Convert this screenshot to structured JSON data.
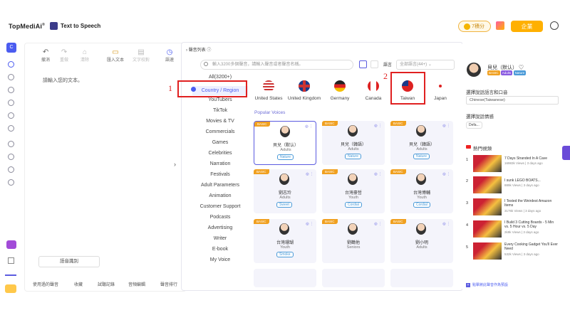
{
  "app": {
    "brand": "TopMediAi",
    "brand_mark": "®",
    "product": "Text to Speech"
  },
  "header": {
    "coins": "0",
    "coins_unit": "7積分",
    "enterprise": "企業"
  },
  "toolbar": {
    "undo": "撤消",
    "redo": "重做",
    "clear": "清除",
    "import": "匯入文本",
    "text_check": "文字校對",
    "speed": "語速"
  },
  "editor": {
    "placeholder": "請輸入您的文本。",
    "voice_clone": "語音識別"
  },
  "bottom_tools": [
    "使用過的聲音",
    "收藏",
    "試聽記錄",
    "音頻編輯",
    "聲音排行"
  ],
  "modal": {
    "title": "聲音列表",
    "search_placeholder": "輸入3200多個聲音，請輸入聲音或者聲音名稱。",
    "sort_label": "語言",
    "sort_value": "全部語言(44+)",
    "categories": [
      "All(3200+)",
      "Country / Region",
      "YouTubers",
      "TikTok",
      "Movies & TV",
      "Commercials",
      "Games",
      "Celebrities",
      "Narration",
      "Festivals",
      "Adult Parameters",
      "Animation",
      "Customer Support",
      "Podcasts",
      "Advertising",
      "Writer",
      "E-book",
      "My Voice"
    ],
    "countries": [
      "United States",
      "United Kingdom",
      "Germany",
      "Canada",
      "Taiwan",
      "Japan"
    ],
    "section_title": "Popular Voices",
    "voices": [
      {
        "badge": "BASIC",
        "name": "貝兒（默认）",
        "age": "Adults",
        "tag": "Nature"
      },
      {
        "badge": "BASIC",
        "name": "貝兒（韓語）",
        "age": "Adults",
        "tag": "Nature"
      },
      {
        "badge": "BASIC",
        "name": "貝兒（韓語）",
        "age": "Adults",
        "tag": "Nature"
      },
      {
        "badge": "BASIC",
        "name": "劉志玲",
        "age": "Adults",
        "tag": "Sweet"
      },
      {
        "badge": "BASIC",
        "name": "台灣豪哲",
        "age": "Youth",
        "tag": "Cordial"
      },
      {
        "badge": "BASIC",
        "name": "台灣博輔",
        "age": "Youth",
        "tag": "Cordial"
      },
      {
        "badge": "BASIC",
        "name": "台灣珊瑚",
        "age": "Youth",
        "tag": "Smoke"
      },
      {
        "badge": "BASIC",
        "name": "劉鶴他",
        "age": "Seniors",
        "tag": ""
      },
      {
        "badge": "BASIC",
        "name": "劉小明",
        "age": "Adults",
        "tag": ""
      }
    ],
    "annotations": [
      "1",
      "2"
    ]
  },
  "right_panel": {
    "voice_name": "貝兒（默认）",
    "badges": [
      "BASIC",
      "Adults",
      "Nature"
    ],
    "lang_label": "選擇說話語言和口音",
    "lang_value": "Chinese(Taiwanese)",
    "style_label": "選擇說話情感",
    "style_value": "Defa...",
    "trending_title": "熱門視頻",
    "videos": [
      {
        "title": "7 Days Stranded In A Cave",
        "meta": "16983k Views | 3 days ago"
      },
      {
        "title": "I sunk LEGO BOATS...",
        "meta": "889k Views | 3 days ago"
      },
      {
        "title": "I Tested the Weirdest Amazon Items",
        "meta": "3176k Views | 3 days ago"
      },
      {
        "title": "I Build 3 Cutting Boards - 5 Min vs. 5 Hour vs. 5 Day",
        "meta": "2k9k Views | 3 days ago"
      },
      {
        "title": "Every Cooking Gadget You'll Ever Need",
        "meta": "532k Views | 3 days ago"
      }
    ],
    "footer_link": "點擊將此聲音作為預設"
  }
}
